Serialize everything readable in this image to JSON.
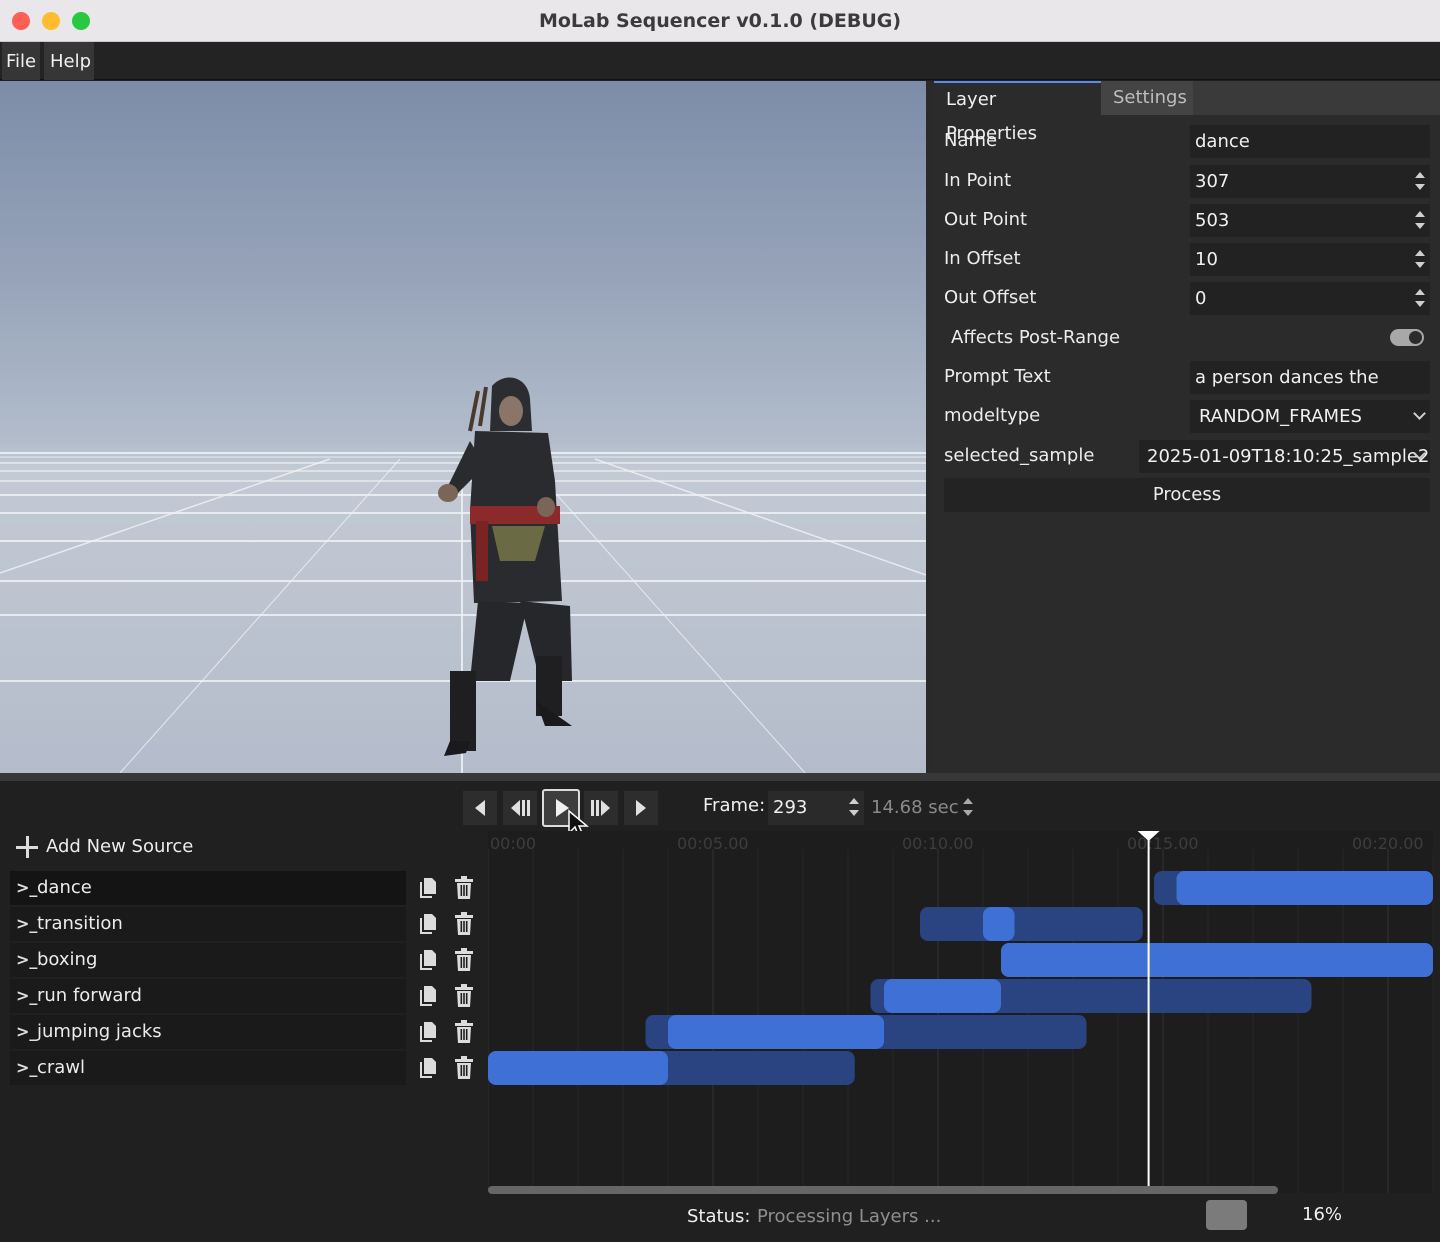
{
  "window": {
    "title": "MoLab Sequencer v0.1.0 (DEBUG)"
  },
  "menu": {
    "items": [
      "File",
      "Help"
    ]
  },
  "properties": {
    "tabs": [
      "Layer Properties",
      "Settings"
    ],
    "fields": {
      "name": {
        "label": "Name",
        "value": "dance"
      },
      "in_point": {
        "label": "In Point",
        "value": "307"
      },
      "out_point": {
        "label": "Out Point",
        "value": "503"
      },
      "in_offset": {
        "label": "In Offset",
        "value": "10"
      },
      "out_offset": {
        "label": "Out Offset",
        "value": "0"
      },
      "affects_post_range": {
        "label": "Affects Post-Range",
        "value": true
      },
      "prompt_text": {
        "label": "Prompt Text",
        "value": "a person dances the tango"
      },
      "modeltype": {
        "label": "modeltype",
        "value": "RANDOM_FRAMES"
      },
      "selected_sample": {
        "label": "selected_sample",
        "value": "2025-01-09T18:10:25_sample2"
      }
    },
    "process_label": "Process"
  },
  "transport": {
    "frame_label": "Frame:",
    "frame_value": "293",
    "seconds_value": "14.68 sec"
  },
  "sources": {
    "add_label": "Add New Source",
    "layers": [
      {
        "name": "dance",
        "selected": true
      },
      {
        "name": "transition",
        "selected": false
      },
      {
        "name": "boxing",
        "selected": false
      },
      {
        "name": "run forward",
        "selected": false
      },
      {
        "name": "jumping jacks",
        "selected": false
      },
      {
        "name": "crawl",
        "selected": false
      }
    ]
  },
  "timeline": {
    "ticks": [
      "00:00",
      "00:05.00",
      "00:10.00",
      "00:15.00",
      "00:20.00"
    ],
    "total_seconds": 21,
    "playhead_seconds": 14.68,
    "bars": [
      {
        "layer": "dance",
        "outer": [
          14.8,
          21
        ],
        "inner": [
          15.3,
          21
        ]
      },
      {
        "layer": "transition",
        "outer": [
          9.6,
          14.55
        ],
        "inner": [
          11.0,
          11.7
        ]
      },
      {
        "layer": "boxing",
        "outer": [
          11.4,
          21
        ],
        "inner": [
          11.4,
          21
        ]
      },
      {
        "layer": "run forward",
        "outer": [
          8.5,
          18.3
        ],
        "inner": [
          8.8,
          11.4
        ]
      },
      {
        "layer": "jumping jacks",
        "outer": [
          3.5,
          13.3
        ],
        "inner": [
          4.0,
          8.8
        ]
      },
      {
        "layer": "crawl",
        "outer": [
          0,
          8.15
        ],
        "inner": [
          0,
          4.0
        ]
      }
    ],
    "colors": {
      "inner": "#3f70d6",
      "outer": "#2a4482",
      "playhead": "#ffffff"
    }
  },
  "status": {
    "label": "Status:",
    "value": "Processing Layers ...",
    "progress_percent": 16,
    "progress_text": "16%"
  }
}
